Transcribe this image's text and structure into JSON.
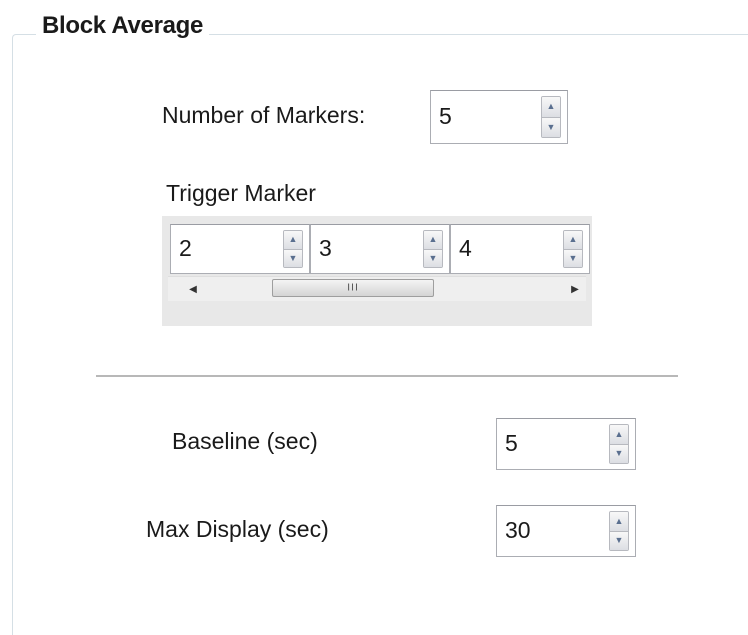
{
  "group": {
    "title": "Block Average"
  },
  "markers": {
    "label": "Number of Markers:",
    "value": "5"
  },
  "trigger": {
    "label": "Trigger Marker",
    "cells": [
      {
        "value": "2"
      },
      {
        "value": "3"
      },
      {
        "value": "4"
      }
    ],
    "scroll_grip": "III"
  },
  "baseline": {
    "label": "Baseline (sec)",
    "value": "5"
  },
  "max_display": {
    "label": "Max Display (sec)",
    "value": "30"
  },
  "icons": {
    "spin_up": "arrow-up-icon",
    "spin_down": "arrow-down-icon",
    "scroll_left": "scroll-left-icon",
    "scroll_right": "scroll-right-icon"
  },
  "colors": {
    "spin_arrow": "#5a6f8f",
    "border": "#abadb3",
    "group_border": "#d5dfe5"
  }
}
